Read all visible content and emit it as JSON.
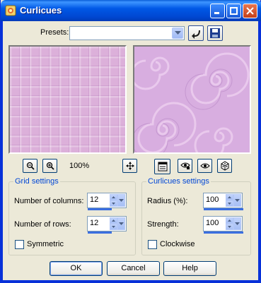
{
  "window": {
    "title": "Curlicues",
    "colors": {
      "title_bar": "#0058e6",
      "frame": "#0831d9",
      "dialog_bg": "#ece9d8",
      "group_title": "#0046d5"
    }
  },
  "presets": {
    "label": "Presets:",
    "value": ""
  },
  "preview": {
    "zoom_label": "100%",
    "left_texture_color": "#dcb0da",
    "right_texture_color": "#d8aee0"
  },
  "grid_settings": {
    "title": "Grid settings",
    "columns_label": "Number of columns:",
    "columns_value": "12",
    "rows_label": "Number of rows:",
    "rows_value": "12",
    "symmetric_label": "Symmetric",
    "symmetric_checked": false
  },
  "curlicues_settings": {
    "title": "Curlicues settings",
    "radius_label": "Radius (%):",
    "radius_value": "100",
    "strength_label": "Strength:",
    "strength_value": "100",
    "clockwise_label": "Clockwise",
    "clockwise_checked": false
  },
  "buttons": {
    "ok": "OK",
    "cancel": "Cancel",
    "help": "Help"
  }
}
